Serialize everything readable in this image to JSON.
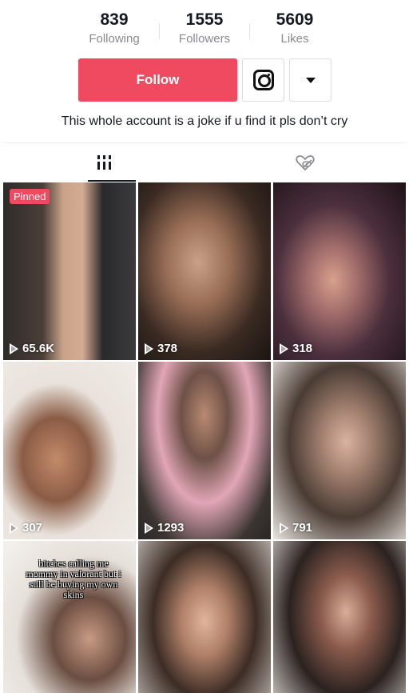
{
  "profile": {
    "stats": [
      {
        "value": "839",
        "label": "Following"
      },
      {
        "value": "1555",
        "label": "Followers"
      },
      {
        "value": "5609",
        "label": "Likes"
      }
    ],
    "follow_label": "Follow",
    "instagram_icon": "instagram-icon",
    "more_icon": "caret-down-icon",
    "bio": "This whole account is a joke if u find it pls don’t cry"
  },
  "tabs": [
    {
      "name": "videos",
      "icon": "grid-icon",
      "active": true
    },
    {
      "name": "liked",
      "icon": "heart-eye-off-icon",
      "active": false
    }
  ],
  "colors": {
    "accent": "#ef4a5f",
    "text": "#161823",
    "muted": "#8a8b91"
  },
  "videos": [
    {
      "views": "65.6K",
      "pinned_label": "Pinned"
    },
    {
      "views": "378"
    },
    {
      "views": "318"
    },
    {
      "views": "307"
    },
    {
      "views": "1293"
    },
    {
      "views": "791"
    },
    {
      "views": "",
      "caption": "bitches calling me mommy in valorant but i still be buying my own skins"
    },
    {
      "views": ""
    },
    {
      "views": ""
    }
  ]
}
